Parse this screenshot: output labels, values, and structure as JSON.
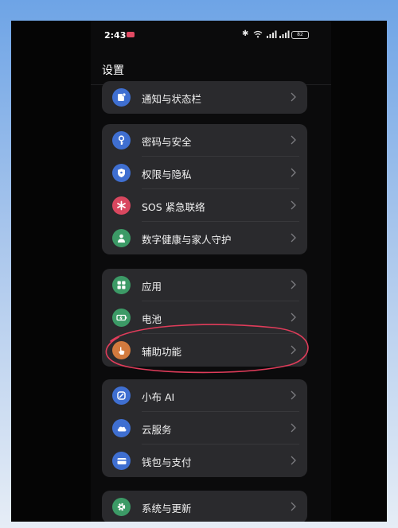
{
  "status_bar": {
    "time": "2:43",
    "battery": "82"
  },
  "header": {
    "title": "设置"
  },
  "groups": [
    {
      "items": [
        {
          "label": "通知与状态栏",
          "icon": "notification-icon",
          "color": "#3f6fd1"
        }
      ]
    },
    {
      "items": [
        {
          "label": "密码与安全",
          "icon": "key-icon",
          "color": "#3f6fd1"
        },
        {
          "label": "权限与隐私",
          "icon": "shield-icon",
          "color": "#3f6fd1"
        },
        {
          "label": "SOS 紧急联络",
          "icon": "sos-asterisk-icon",
          "color": "#d9475f"
        },
        {
          "label": "数字健康与家人守护",
          "icon": "person-icon",
          "color": "#3c9a66"
        }
      ]
    },
    {
      "items": [
        {
          "label": "应用",
          "icon": "apps-grid-icon",
          "color": "#3c9a66"
        },
        {
          "label": "电池",
          "icon": "battery-icon",
          "color": "#3c9a66"
        },
        {
          "label": "辅助功能",
          "icon": "hand-touch-icon",
          "color": "#d27a3e"
        }
      ]
    },
    {
      "items": [
        {
          "label": "小布 AI",
          "icon": "assistant-icon",
          "color": "#3f6fd1"
        },
        {
          "label": "云服务",
          "icon": "cloud-icon",
          "color": "#3f6fd1"
        },
        {
          "label": "钱包与支付",
          "icon": "wallet-icon",
          "color": "#3f6fd1"
        }
      ]
    },
    {
      "items": [
        {
          "label": "系统与更新",
          "icon": "gear-icon",
          "color": "#3c9a66"
        }
      ]
    }
  ]
}
